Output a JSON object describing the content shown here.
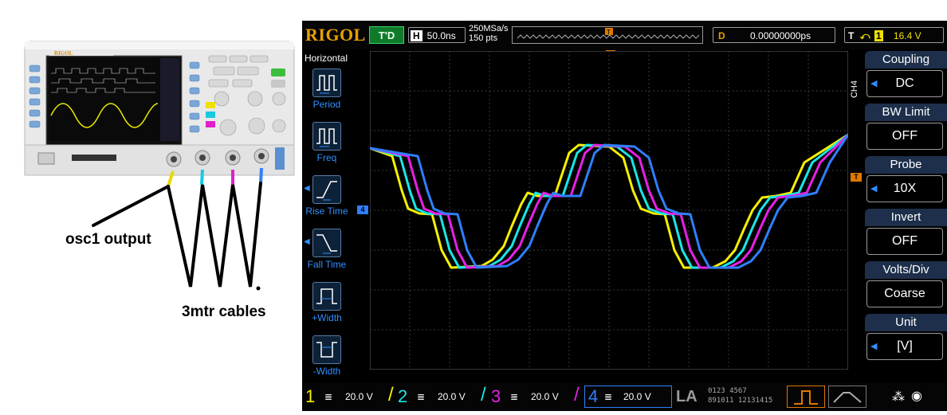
{
  "annotations": {
    "osc_output": "osc1 output",
    "cables": "3mtr cables"
  },
  "scope": {
    "brand": "RIGOL",
    "status": "T'D",
    "timebase": {
      "label": "H",
      "value": "50.0ns"
    },
    "sample_rate": "250MSa/s",
    "points": "150 pts",
    "delay": {
      "label": "D",
      "value": "0.00000000ps"
    },
    "trigger": {
      "label": "T",
      "source": "1",
      "level": "16.4 V"
    },
    "left_menu": {
      "title": "Horizontal",
      "items": [
        "Period",
        "Freq",
        "Rise Time",
        "Fall Time",
        "+Width",
        "-Width"
      ]
    },
    "channel_tag": "CH4",
    "right_menu": [
      {
        "title": "Coupling",
        "value": "DC",
        "arrow": true
      },
      {
        "title": "BW Limit",
        "value": "OFF",
        "arrow": false
      },
      {
        "title": "Probe",
        "value": "10X",
        "arrow": true
      },
      {
        "title": "Invert",
        "value": "OFF",
        "arrow": false
      },
      {
        "title": "Volts/Div",
        "value": "Coarse",
        "arrow": false
      },
      {
        "title": "Unit",
        "value": "[V]",
        "arrow": true
      }
    ],
    "channels": [
      {
        "num": "1",
        "scale": "20.0 V",
        "color": "#f5f000"
      },
      {
        "num": "2",
        "scale": "20.0 V",
        "color": "#19e6e6"
      },
      {
        "num": "3",
        "scale": "20.0 V",
        "color": "#e620e6"
      },
      {
        "num": "4",
        "scale": "20.0 V",
        "color": "#2f7fff"
      }
    ],
    "la_label": "LA",
    "la_digits_top": "0123 4567",
    "la_digits_bottom": "891011 12131415",
    "trigger_marker": "T",
    "ch4_marker": "4"
  }
}
